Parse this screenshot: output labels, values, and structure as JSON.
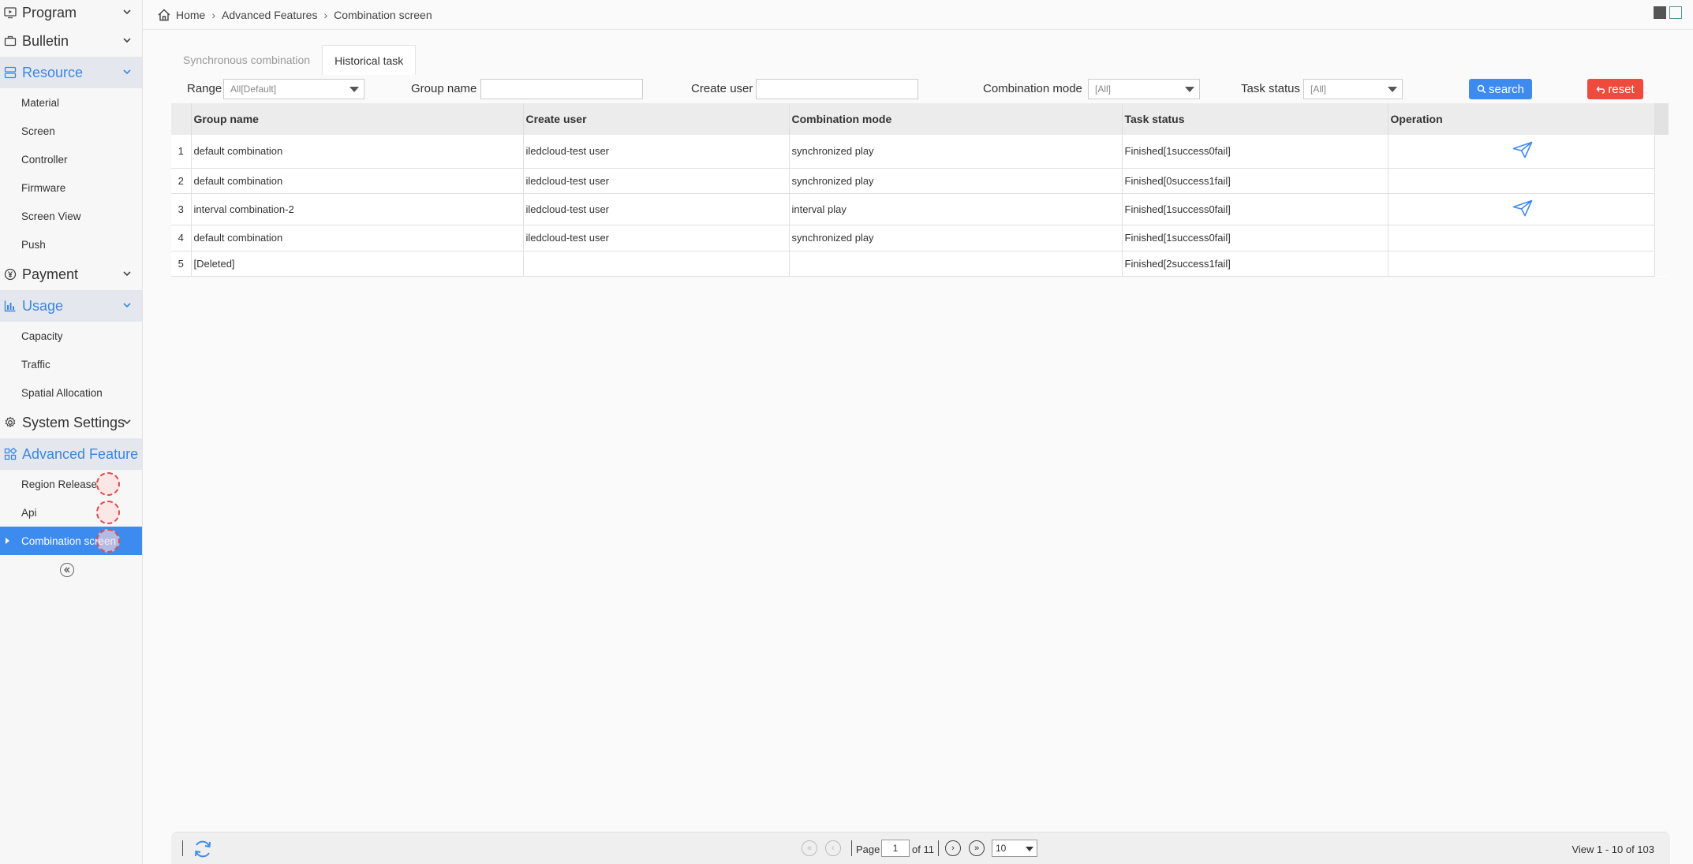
{
  "sidebar": {
    "program": "Program",
    "bulletin": "Bulletin",
    "resource": "Resource",
    "resource_items": [
      "Material",
      "Screen",
      "Controller",
      "Firmware",
      "Screen View",
      "Push"
    ],
    "payment": "Payment",
    "usage": "Usage",
    "usage_items": [
      "Capacity",
      "Traffic",
      "Spatial Allocation"
    ],
    "system_settings": "System Settings",
    "advanced_features": "Advanced Feature",
    "advanced_items": [
      "Region Release",
      "Api",
      "Combination screen"
    ]
  },
  "breadcrumb": {
    "home": "Home",
    "section": "Advanced Features",
    "page": "Combination screen"
  },
  "tabs": [
    "Synchronous combination",
    "Historical task"
  ],
  "filters": {
    "range_label": "Range",
    "range_value": "All[Default]",
    "group_name_label": "Group name",
    "create_user_label": "Create user",
    "combination_mode_label": "Combination mode",
    "combination_mode_value": "[All]",
    "task_status_label": "Task status",
    "task_status_value": "[All]",
    "search_label": "search",
    "reset_label": "reset"
  },
  "table": {
    "headers": [
      "Group name",
      "Create user",
      "Combination mode",
      "Task status",
      "Operation"
    ],
    "rows": [
      {
        "n": "1",
        "group": "default combination",
        "user": "iledcloud-test user",
        "mode": "synchronized play",
        "status": "Finished[1success0fail]",
        "op": true
      },
      {
        "n": "2",
        "group": "default combination",
        "user": "iledcloud-test user",
        "mode": "synchronized play",
        "status": "Finished[0success1fail]",
        "op": false
      },
      {
        "n": "3",
        "group": "interval combination-2",
        "user": "iledcloud-test user",
        "mode": "interval play",
        "status": "Finished[1success0fail]",
        "op": true
      },
      {
        "n": "4",
        "group": "default combination",
        "user": "iledcloud-test user",
        "mode": "synchronized play",
        "status": "Finished[1success0fail]",
        "op": false
      },
      {
        "n": "5",
        "group": "[Deleted]",
        "user": "",
        "mode": "",
        "status": "Finished[2success1fail]",
        "op": false
      }
    ]
  },
  "pager": {
    "page_label": "Page",
    "page_value": "1",
    "of_label": "of 11",
    "page_size": "10",
    "view_text": "View 1 - 10 of 103"
  },
  "colors": {
    "accent": "#3d8bef",
    "danger": "#ee4b3e"
  }
}
